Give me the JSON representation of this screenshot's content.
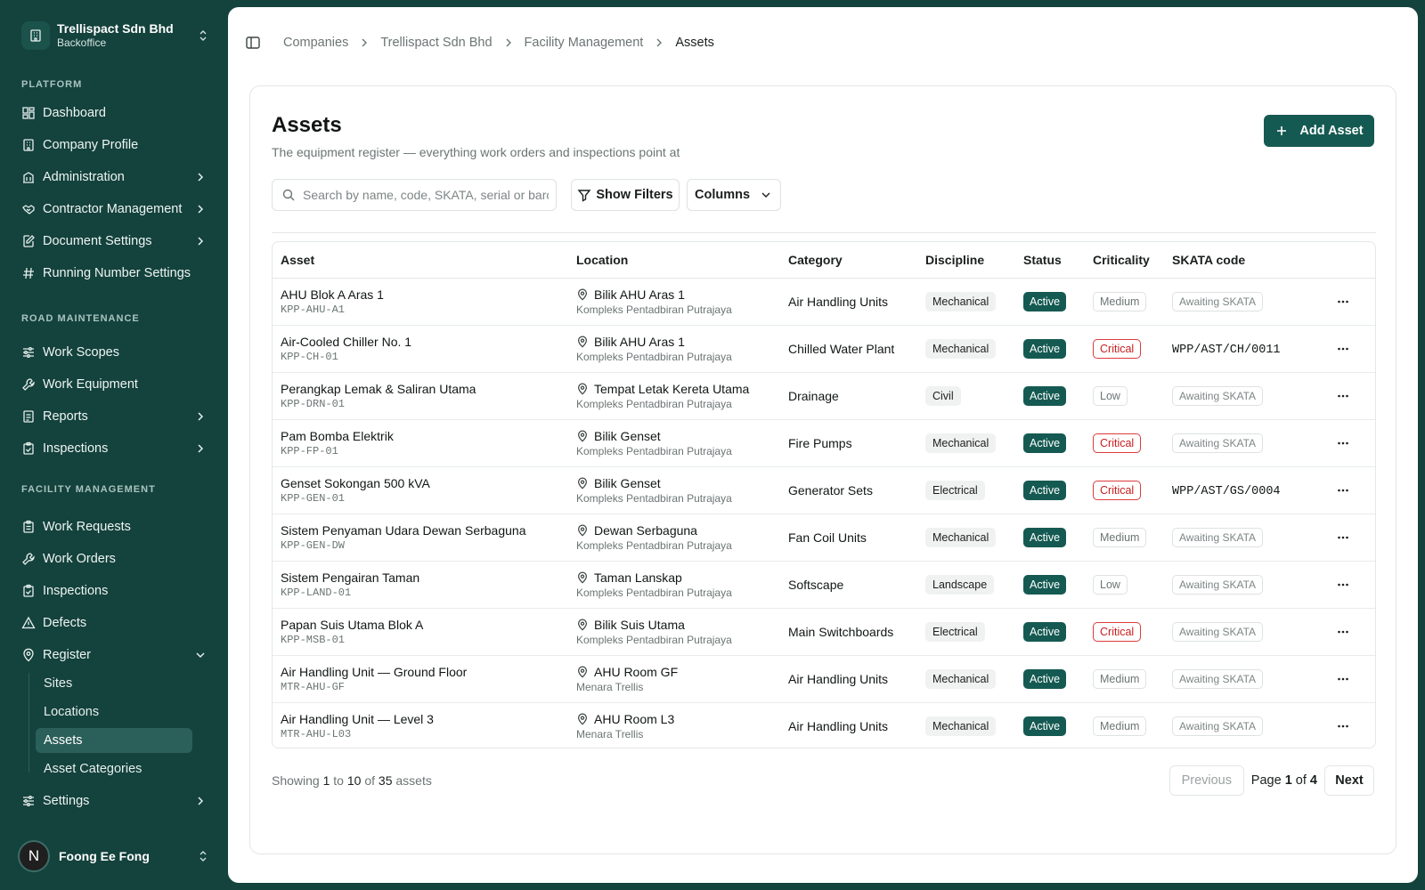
{
  "company": {
    "name": "Trellispact Sdn Bhd",
    "subtitle": "Backoffice"
  },
  "sidebar": {
    "sections": [
      {
        "label": "PLATFORM",
        "items": [
          {
            "label": "Dashboard",
            "icon": "dashboard-icon"
          },
          {
            "label": "Company Profile",
            "icon": "building-icon"
          },
          {
            "label": "Administration",
            "icon": "building-icon"
          },
          {
            "label": "Contractor Management",
            "icon": "handshake-icon"
          },
          {
            "label": "Document Settings",
            "icon": "edit-document-icon"
          },
          {
            "label": "Running Number Settings",
            "icon": "hash-icon"
          }
        ]
      },
      {
        "label": "ROAD MAINTENANCE",
        "items": [
          {
            "label": "Work Scopes",
            "icon": "sliders-icon"
          },
          {
            "label": "Work Equipment",
            "icon": "wrench-icon"
          },
          {
            "label": "Reports",
            "icon": "document-icon"
          },
          {
            "label": "Inspections",
            "icon": "clipboard-check-icon"
          }
        ]
      },
      {
        "label": "FACILITY MANAGEMENT",
        "items": [
          {
            "label": "Work Requests",
            "icon": "clipboard-list-icon"
          },
          {
            "label": "Work Orders",
            "icon": "wrench-icon"
          },
          {
            "label": "Inspections",
            "icon": "clipboard-check-icon"
          },
          {
            "label": "Defects",
            "icon": "warning-icon"
          },
          {
            "label": "Register",
            "icon": "map-pin-icon"
          }
        ]
      }
    ],
    "register_children": [
      "Sites",
      "Locations",
      "Assets",
      "Asset Categories"
    ],
    "settings": "Settings"
  },
  "user": {
    "initial": "N",
    "name": "Foong Ee Fong"
  },
  "breadcrumb": [
    "Companies",
    "Trellispact Sdn Bhd",
    "Facility Management",
    "Assets"
  ],
  "page": {
    "title": "Assets",
    "description": "The equipment register — everything work orders and inspections point at",
    "add_button": "Add Asset"
  },
  "toolbar": {
    "search_placeholder": "Search by name, code, SKATA, serial or barcode",
    "filters_button": "Show Filters",
    "columns_button": "Columns"
  },
  "table": {
    "headers": [
      "Asset",
      "Location",
      "Category",
      "Discipline",
      "Status",
      "Criticality",
      "SKATA code"
    ],
    "rows": [
      {
        "name": "AHU Blok A Aras 1",
        "code": "KPP-AHU-A1",
        "location": "Bilik AHU Aras 1",
        "site": "Kompleks Pentadbiran Putrajaya",
        "category": "Air Handling Units",
        "discipline": "Mechanical",
        "status": "Active",
        "criticality": "Medium",
        "skata": "Awaiting SKATA"
      },
      {
        "name": "Air-Cooled Chiller No. 1",
        "code": "KPP-CH-01",
        "location": "Bilik AHU Aras 1",
        "site": "Kompleks Pentadbiran Putrajaya",
        "category": "Chilled Water Plant",
        "discipline": "Mechanical",
        "status": "Active",
        "criticality": "Critical",
        "skata": "WPP/AST/CH/0011"
      },
      {
        "name": "Perangkap Lemak & Saliran Utama",
        "code": "KPP-DRN-01",
        "location": "Tempat Letak Kereta Utama",
        "site": "Kompleks Pentadbiran Putrajaya",
        "category": "Drainage",
        "discipline": "Civil",
        "status": "Active",
        "criticality": "Low",
        "skata": "Awaiting SKATA"
      },
      {
        "name": "Pam Bomba Elektrik",
        "code": "KPP-FP-01",
        "location": "Bilik Genset",
        "site": "Kompleks Pentadbiran Putrajaya",
        "category": "Fire Pumps",
        "discipline": "Mechanical",
        "status": "Active",
        "criticality": "Critical",
        "skata": "Awaiting SKATA"
      },
      {
        "name": "Genset Sokongan 500 kVA",
        "code": "KPP-GEN-01",
        "location": "Bilik Genset",
        "site": "Kompleks Pentadbiran Putrajaya",
        "category": "Generator Sets",
        "discipline": "Electrical",
        "status": "Active",
        "criticality": "Critical",
        "skata": "WPP/AST/GS/0004"
      },
      {
        "name": "Sistem Penyaman Udara Dewan Serbaguna",
        "code": "KPP-GEN-DW",
        "location": "Dewan Serbaguna",
        "site": "Kompleks Pentadbiran Putrajaya",
        "category": "Fan Coil Units",
        "discipline": "Mechanical",
        "status": "Active",
        "criticality": "Medium",
        "skata": "Awaiting SKATA"
      },
      {
        "name": "Sistem Pengairan Taman",
        "code": "KPP-LAND-01",
        "location": "Taman Lanskap",
        "site": "Kompleks Pentadbiran Putrajaya",
        "category": "Softscape",
        "discipline": "Landscape",
        "status": "Active",
        "criticality": "Low",
        "skata": "Awaiting SKATA"
      },
      {
        "name": "Papan Suis Utama Blok A",
        "code": "KPP-MSB-01",
        "location": "Bilik Suis Utama",
        "site": "Kompleks Pentadbiran Putrajaya",
        "category": "Main Switchboards",
        "discipline": "Electrical",
        "status": "Active",
        "criticality": "Critical",
        "skata": "Awaiting SKATA"
      },
      {
        "name": "Air Handling Unit — Ground Floor",
        "code": "MTR-AHU-GF",
        "location": "AHU Room GF",
        "site": "Menara Trellis",
        "category": "Air Handling Units",
        "discipline": "Mechanical",
        "status": "Active",
        "criticality": "Medium",
        "skata": "Awaiting SKATA"
      },
      {
        "name": "Air Handling Unit — Level 3",
        "code": "MTR-AHU-L03",
        "location": "AHU Room L3",
        "site": "Menara Trellis",
        "category": "Air Handling Units",
        "discipline": "Mechanical",
        "status": "Active",
        "criticality": "Medium",
        "skata": "Awaiting SKATA"
      }
    ]
  },
  "footer": {
    "prefix": "Showing",
    "from": "1",
    "to_word": "to",
    "to": "10",
    "of_word": "of",
    "total": "35",
    "suffix": "assets",
    "previous": "Previous",
    "page_word": "Page",
    "page": "1",
    "page_of": "of",
    "pages": "4",
    "next": "Next"
  },
  "colors": {
    "sidebar_bg": "#14423d",
    "accent": "#155a52",
    "critical": "#c81e1e"
  }
}
